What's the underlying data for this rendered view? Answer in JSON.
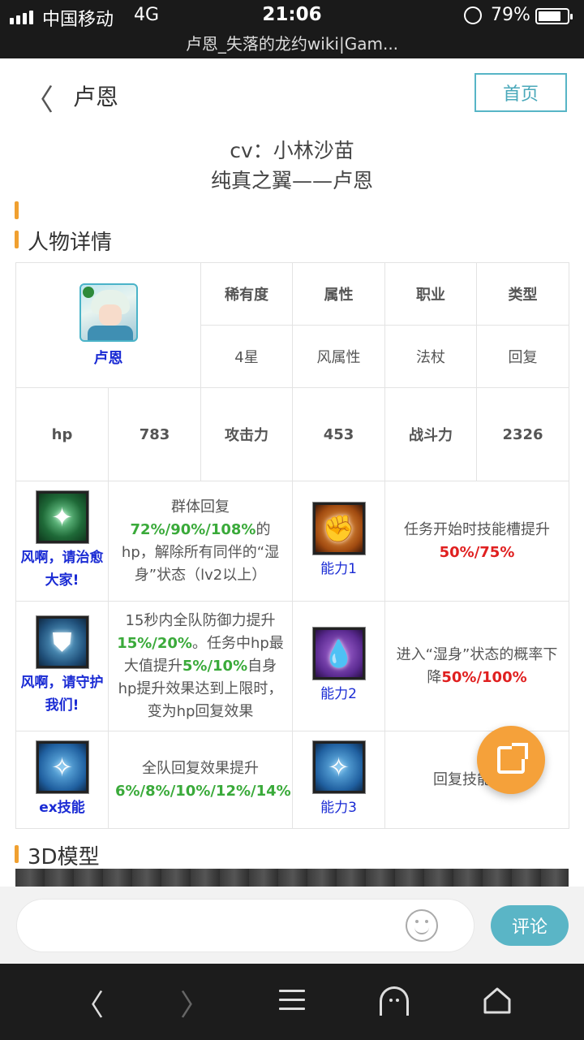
{
  "status_bar": {
    "carrier": "中国移动",
    "network": "4G",
    "time": "21:06",
    "battery": "79%",
    "battery_level": 0.79,
    "url_title": "卢恩_失落的龙约wiki|Gam..."
  },
  "header": {
    "back_glyph": "〈",
    "title": "卢恩",
    "home_label": "首页"
  },
  "intro": {
    "cv": "cv：小林沙苗",
    "full_name": "纯真之翼——卢恩"
  },
  "sections": {
    "details": "人物详情",
    "model": "3D模型"
  },
  "character": {
    "name": "卢恩",
    "headers": [
      "稀有度",
      "属性",
      "职业",
      "类型"
    ],
    "values": [
      "4星",
      "风属性",
      "法杖",
      "回复"
    ],
    "stats": {
      "hp_label": "hp",
      "hp": "783",
      "atk_label": "攻击力",
      "atk": "453",
      "power_label": "战斗力",
      "power": "2326"
    }
  },
  "skills": {
    "s1": {
      "name": "风啊，请治愈大家!",
      "desc": [
        "群体回复",
        "72%/90%/108%",
        "的hp，解除所有同伴的“湿身”状态（lv2以上）"
      ]
    },
    "s2": {
      "name": "风啊，请守护我们!",
      "desc": [
        "15秒内全队防御力提升",
        "15%/20%",
        "。任务中hp最大值提升",
        "5%/10%",
        "自身hp提升效果达到上限时，变为hp回复效果"
      ]
    },
    "ex": {
      "name": "ex技能",
      "desc": [
        "全队回复效果提升",
        "6%/8%/10%/12%/14%"
      ]
    }
  },
  "abilities": {
    "a1": {
      "name": "能力1",
      "desc": [
        "任务开始时技能槽提升",
        "50%/75%"
      ]
    },
    "a2": {
      "name": "能力2",
      "desc": [
        "进入“湿身”状态的概率下降",
        "50%/100%"
      ]
    },
    "a3": {
      "name": "能力3",
      "desc": [
        "回复技能效果"
      ]
    }
  },
  "comment": {
    "placeholder": "",
    "button": "评论"
  },
  "nav": {
    "back_glyph": "〈",
    "forward_glyph": "〉"
  },
  "colors": {
    "accent": "#57b5c6",
    "orange": "#f5a13a",
    "green": "#33aa44",
    "red": "#e02020",
    "navy": "#1a2bd4",
    "blue": "#3399dd"
  },
  "icons": [
    "signal-icon",
    "lock-rotation-icon",
    "battery-icon",
    "back-icon",
    "share-icon",
    "smile-icon",
    "menu-icon",
    "ghost-icon",
    "home-icon"
  ]
}
